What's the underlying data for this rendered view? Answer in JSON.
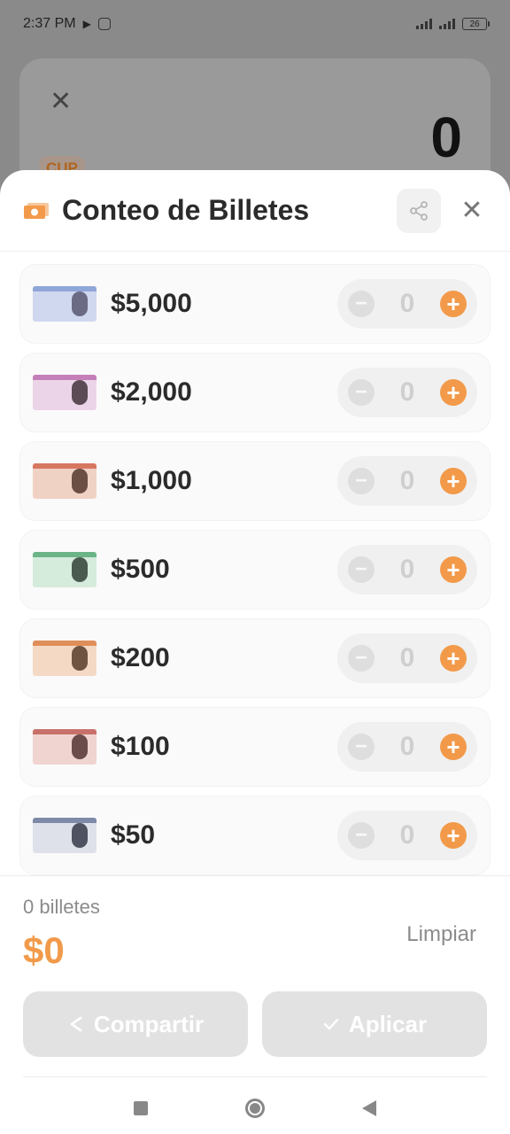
{
  "status_bar": {
    "time": "2:37 PM",
    "battery": "26"
  },
  "background_card": {
    "amount": "0",
    "currency": "CUP"
  },
  "sheet": {
    "title": "Conteo de Billetes",
    "bills": [
      {
        "denomination": "$5,000",
        "count": "0",
        "colors": {
          "base": "#cfd8ef",
          "accent": "#8fa6d8",
          "face": "#6b6b84"
        }
      },
      {
        "denomination": "$2,000",
        "count": "0",
        "colors": {
          "base": "#ecd4e8",
          "accent": "#c47fb9",
          "face": "#5c4a55"
        }
      },
      {
        "denomination": "$1,000",
        "count": "0",
        "colors": {
          "base": "#f0d2c4",
          "accent": "#d77760",
          "face": "#6b4f44"
        }
      },
      {
        "denomination": "$500",
        "count": "0",
        "colors": {
          "base": "#d5ebdc",
          "accent": "#6bb487",
          "face": "#4b5a4f"
        }
      },
      {
        "denomination": "$200",
        "count": "0",
        "colors": {
          "base": "#f4d9c4",
          "accent": "#e08f5a",
          "face": "#6f5442"
        }
      },
      {
        "denomination": "$100",
        "count": "0",
        "colors": {
          "base": "#f0d4d0",
          "accent": "#c8716a",
          "face": "#6b4c4a"
        }
      },
      {
        "denomination": "$50",
        "count": "0",
        "colors": {
          "base": "#dfe1ea",
          "accent": "#7d8aa8",
          "face": "#4f5260"
        }
      }
    ]
  },
  "footer": {
    "count_label": "0 billetes",
    "total": "$0",
    "clear_label": "Limpiar",
    "share_label": "Compartir",
    "apply_label": "Aplicar"
  },
  "colors": {
    "accent": "#f29a4a",
    "disabled": "#e2e2e2"
  }
}
